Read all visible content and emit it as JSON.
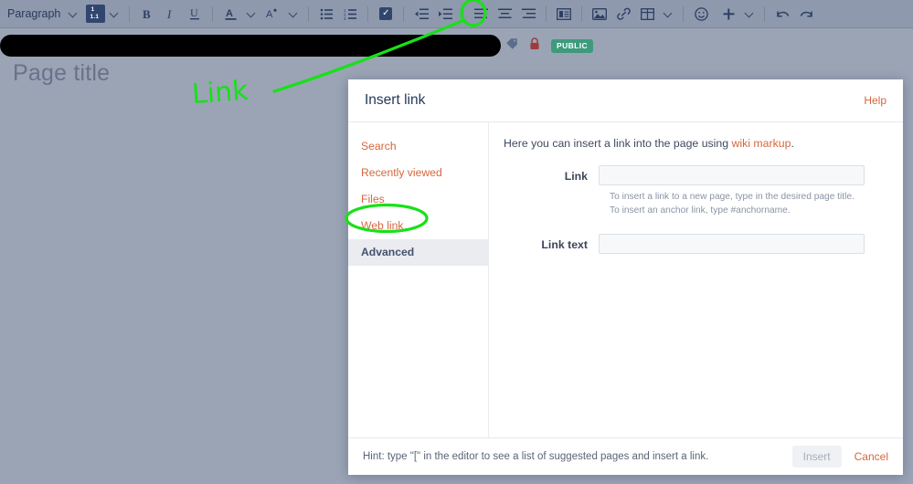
{
  "toolbar": {
    "paragraph_label": "Paragraph",
    "numbered_heading_top": "1",
    "numbered_heading_bottom": "1.1",
    "checkmark_glyph": "✓",
    "items": [
      {
        "name": "paragraph-style-dropdown",
        "label": "Paragraph"
      },
      {
        "name": "numbered-heading-dropdown",
        "label": "1 / 1.1"
      },
      {
        "name": "bold-button",
        "label": "B"
      },
      {
        "name": "italic-button",
        "label": "I"
      },
      {
        "name": "underline-button",
        "label": "U"
      },
      {
        "name": "text-color-dropdown",
        "label": "A"
      },
      {
        "name": "clear-formatting-dropdown",
        "label": "A"
      },
      {
        "name": "bullet-list-button",
        "label": "Bullet list"
      },
      {
        "name": "numbered-list-button",
        "label": "Numbered list"
      },
      {
        "name": "task-list-button",
        "label": "Task list"
      },
      {
        "name": "outdent-button",
        "label": "Outdent"
      },
      {
        "name": "indent-button",
        "label": "Indent"
      },
      {
        "name": "align-left-button",
        "label": "Align left"
      },
      {
        "name": "align-center-button",
        "label": "Align center"
      },
      {
        "name": "align-right-button",
        "label": "Align right"
      },
      {
        "name": "page-layout-button",
        "label": "Page layout"
      },
      {
        "name": "insert-image-button",
        "label": "Insert image"
      },
      {
        "name": "insert-link-button",
        "label": "Insert link"
      },
      {
        "name": "insert-table-dropdown",
        "label": "Table"
      },
      {
        "name": "insert-emoji-button",
        "label": "Emoji"
      },
      {
        "name": "insert-more-dropdown",
        "label": "Insert more"
      },
      {
        "name": "undo-button",
        "label": "Undo"
      },
      {
        "name": "redo-button",
        "label": "Redo"
      }
    ]
  },
  "page": {
    "title_placeholder": "Page title",
    "visibility_badge": "PUBLIC"
  },
  "annotations": {
    "handwritten_label": "Link",
    "color": "#19e019"
  },
  "modal": {
    "title": "Insert link",
    "help_label": "Help",
    "nav": [
      {
        "label": "Search",
        "selected": false
      },
      {
        "label": "Recently viewed",
        "selected": false
      },
      {
        "label": "Files",
        "selected": false
      },
      {
        "label": "Web link",
        "selected": false
      },
      {
        "label": "Advanced",
        "selected": true
      }
    ],
    "intro_prefix": "Here you can insert a link into the page using ",
    "intro_link": "wiki markup",
    "intro_suffix": ".",
    "link_field": {
      "label": "Link",
      "value": "",
      "placeholder": ""
    },
    "hints": [
      "To insert a link to a new page, type in the desired page title.",
      "To insert an anchor link, type #anchorname."
    ],
    "link_text_field": {
      "label": "Link text",
      "value": "",
      "placeholder": ""
    },
    "footer_hint": "Hint: type \"[\" in the editor to see a list of suggested pages and insert a link.",
    "insert_label": "Insert",
    "cancel_label": "Cancel"
  },
  "colors": {
    "accent_link": "#d6673c",
    "badge_green": "#3d9b7c",
    "overlay_bg": "#9aa4b5",
    "annotation_green": "#19e019"
  }
}
